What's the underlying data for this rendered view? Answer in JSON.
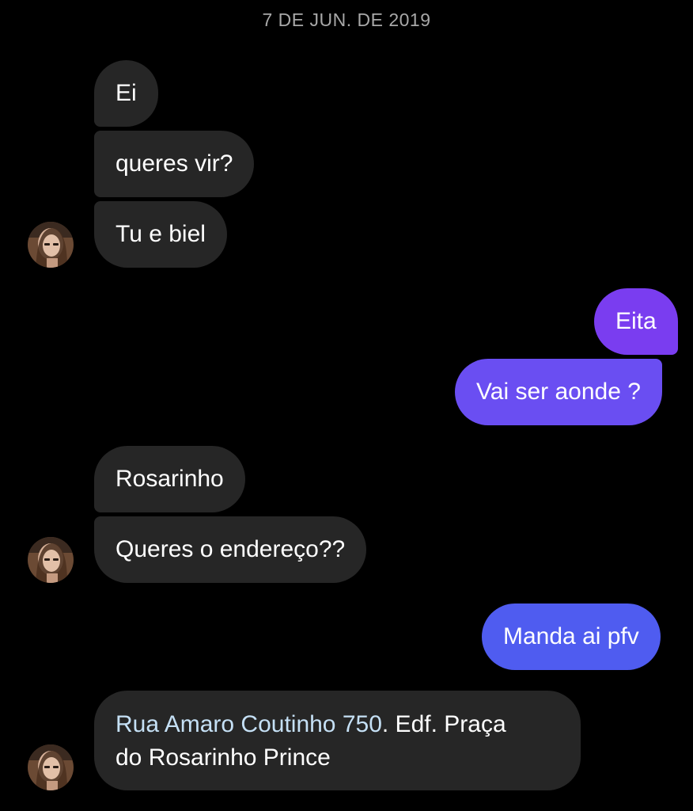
{
  "thread": {
    "date_header": "7 DE JUN. DE 2019"
  },
  "messages": [
    {
      "from": "them",
      "text": "Ei"
    },
    {
      "from": "them",
      "text": "queres vir?"
    },
    {
      "from": "them",
      "text": "Tu e biel"
    },
    {
      "from": "me",
      "text": "Eita"
    },
    {
      "from": "me",
      "text": "Vai ser aonde ?"
    },
    {
      "from": "them",
      "text": "Rosarinho"
    },
    {
      "from": "them",
      "text": "Queres o endereço??"
    },
    {
      "from": "me",
      "text": "Manda ai pfv"
    },
    {
      "from": "them",
      "link_text": "Rua Amaro Coutinho 750",
      "text_rest": ". Edf. Praça",
      "text_line2": "do Rosarinho Prince"
    }
  ],
  "colors": {
    "background": "#000000",
    "incoming_bubble": "#262626",
    "outgoing_top": "#7a3df0",
    "outgoing_mid": "#6a4ef2",
    "outgoing_bottom": "#4f5cf0",
    "date_text": "#a8a8a8",
    "link_text": "#c5e0f5"
  },
  "icons": {
    "avatar": "user-avatar-photo"
  }
}
